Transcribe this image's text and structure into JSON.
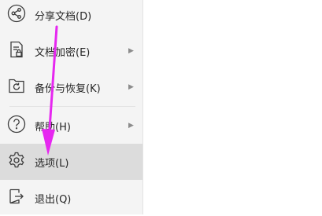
{
  "menu": {
    "items": [
      {
        "label": "分享文档(D)",
        "icon": "share-icon",
        "submenu": false
      },
      {
        "label": "文档加密(E)",
        "icon": "document-lock-icon",
        "submenu": true,
        "chevron": "▶"
      },
      {
        "label": "备份与恢复(K)",
        "icon": "backup-restore-icon",
        "submenu": true,
        "chevron": "▶"
      },
      {
        "label": "帮助(H)",
        "icon": "help-icon",
        "submenu": true,
        "chevron": "▶"
      },
      {
        "label": "选项(L)",
        "icon": "gear-icon",
        "submenu": false,
        "selected": true
      },
      {
        "label": "退出(Q)",
        "icon": "exit-icon",
        "submenu": false
      }
    ]
  },
  "colors": {
    "panel_bg": "#f4f4f4",
    "selected_bg": "#dcdcdc",
    "icon_stroke": "#3c3c3c",
    "annotation": "#e627f0"
  }
}
